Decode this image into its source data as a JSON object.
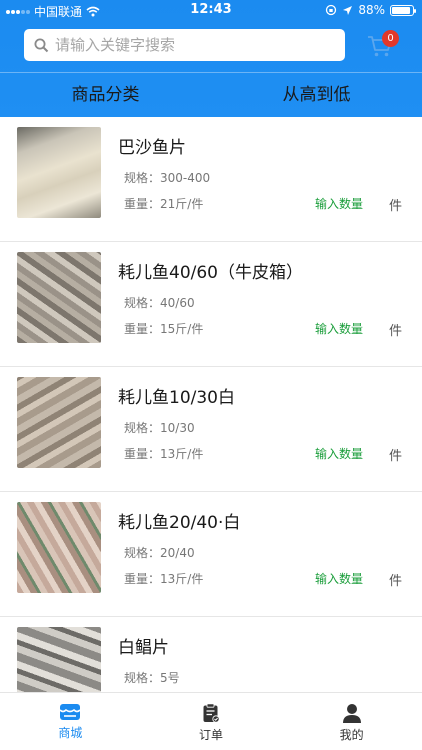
{
  "status_bar": {
    "carrier": "中国联通",
    "time": "12:43",
    "battery": "88%",
    "battery_level": 0.88
  },
  "search": {
    "placeholder": "请输入关键字搜索",
    "value": ""
  },
  "cart": {
    "icon": "cart-icon",
    "badge": "0"
  },
  "tabs": [
    {
      "label": "商品分类"
    },
    {
      "label": "从高到低"
    }
  ],
  "colors": {
    "brand_blue": "#1b8bf0",
    "accent_green": "#1b9e3b",
    "badge_red": "#e2382a"
  },
  "products": [
    {
      "name": "巴沙鱼片",
      "spec": "规格：300-400",
      "weight": "重量：21斤/件",
      "qty_label": "输入数量",
      "unit": "件"
    },
    {
      "name": "耗儿鱼40/60（牛皮箱）",
      "spec": "规格：40/60",
      "weight": "重量：15斤/件",
      "qty_label": "输入数量",
      "unit": "件"
    },
    {
      "name": "耗儿鱼10/30白",
      "spec": "规格：10/30",
      "weight": "重量：13斤/件",
      "qty_label": "输入数量",
      "unit": "件"
    },
    {
      "name": "耗儿鱼20/40·白",
      "spec": "规格：20/40",
      "weight": "重量：13斤/件",
      "qty_label": "输入数量",
      "unit": "件"
    },
    {
      "name": "白鲳片",
      "spec": "规格：5号",
      "weight": "",
      "qty_label": "",
      "unit": ""
    }
  ],
  "bottom_nav": [
    {
      "label": "商城",
      "icon": "store-icon",
      "active": true
    },
    {
      "label": "订单",
      "icon": "order-clipboard-icon",
      "active": false
    },
    {
      "label": "我的",
      "icon": "profile-icon",
      "active": false
    }
  ]
}
